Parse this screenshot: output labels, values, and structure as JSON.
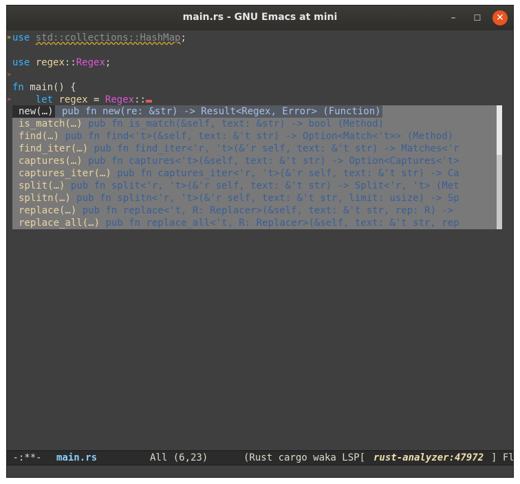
{
  "window": {
    "title": "main.rs - GNU Emacs at mini",
    "minimize": "–",
    "maximize": "☐",
    "close": "✕"
  },
  "editor": {
    "line1": {
      "kw": "use",
      "path": "std::collections::HashMap",
      "end": ";"
    },
    "line3": {
      "kw": "use",
      "mod": "regex",
      "sep": "::",
      "ty": "Regex",
      "end": ";"
    },
    "line5": {
      "kw": "fn",
      "name": " main() {"
    },
    "line6": {
      "indent": "    ",
      "kw": "let",
      "var": "regex",
      "eq": " = ",
      "ty": "Regex",
      "sep": "::"
    }
  },
  "completions": [
    {
      "cand": "new(…)",
      "ann": " pub fn new(re: &str) -> Result<Regex, Error> (Function)"
    },
    {
      "cand": "is_match(…)",
      "ann": " pub fn is_match(&self, text: &str) -> bool (Method)"
    },
    {
      "cand": "find(…)",
      "ann": " pub fn find<'t>(&self, text: &'t str) -> Option<Match<'t>> (Method)"
    },
    {
      "cand": "find_iter(…)",
      "ann": " pub fn find_iter<'r, 't>(&'r self, text: &'t str) -> Matches<'r"
    },
    {
      "cand": "captures(…)",
      "ann": " pub fn captures<'t>(&self, text: &'t str) -> Option<Captures<'t>"
    },
    {
      "cand": "captures_iter(…)",
      "ann": " pub fn captures_iter<'r, 't>(&'r self, text: &'t str) -> Ca"
    },
    {
      "cand": "split(…)",
      "ann": " pub fn split<'r, 't>(&'r self, text: &'t str) -> Split<'r, 't> (Met"
    },
    {
      "cand": "splitn(…)",
      "ann": " pub fn splitn<'r, 't>(&'r self, text: &'t str, limit: usize) -> Sp"
    },
    {
      "cand": "replace(…)",
      "ann": " pub fn replace<'t, R: Replacer>(&self, text: &'t str, rep: R) ->"
    },
    {
      "cand": "replace_all(…)",
      "ann": " pub fn replace_all<'t, R: Replacer>(&self, text: &'t str, rep"
    }
  ],
  "modeline": {
    "status": " -:**-",
    "file": "main.rs",
    "position": "All (6,23)",
    "modes_open": "(Rust cargo waka LSP[",
    "lsp_server": "rust-analyzer:47972",
    "modes_close": "] Fl"
  },
  "colors": {
    "keyword": "#36b4ff",
    "type": "#e055d8",
    "variable": "#ead49f",
    "error": "#e05a5a"
  }
}
